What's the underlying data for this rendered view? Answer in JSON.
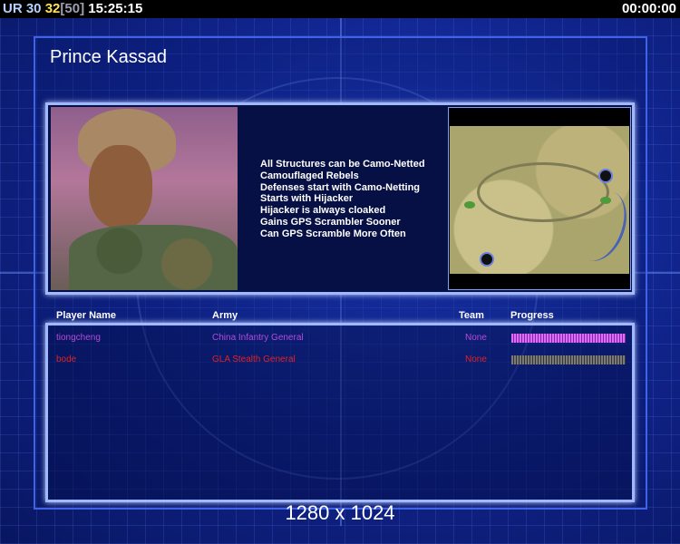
{
  "hud": {
    "ur_label": "UR",
    "ur_value": "30",
    "players_count": "32",
    "players_max": "[50]",
    "clock": "15:25:15",
    "timer": "00:00:00"
  },
  "screen_title": "Prince Kassad",
  "general_traits": [
    "All Structures can be Camo-Netted",
    "Camouflaged Rebels",
    "Defenses start with Camo-Netting",
    "Starts with Hijacker",
    "Hijacker is always cloaked",
    "Gains GPS Scrambler Sooner",
    "Can GPS Scramble More Often"
  ],
  "table": {
    "headers": {
      "player": "Player Name",
      "army": "Army",
      "team": "Team",
      "progress": "Progress"
    },
    "rows": [
      {
        "name": "tiongcheng",
        "army": "China Infantry General",
        "team": "None",
        "color": "#b64ad9",
        "progress": 1.0
      },
      {
        "name": "bode",
        "army": "GLA Stealth General",
        "team": "None",
        "color": "#e32222",
        "progress": 1.0
      }
    ]
  },
  "resolution": "1280 x 1024",
  "colors": {
    "panel_border": "#9fb8ff",
    "background": "#0a1a6e"
  }
}
